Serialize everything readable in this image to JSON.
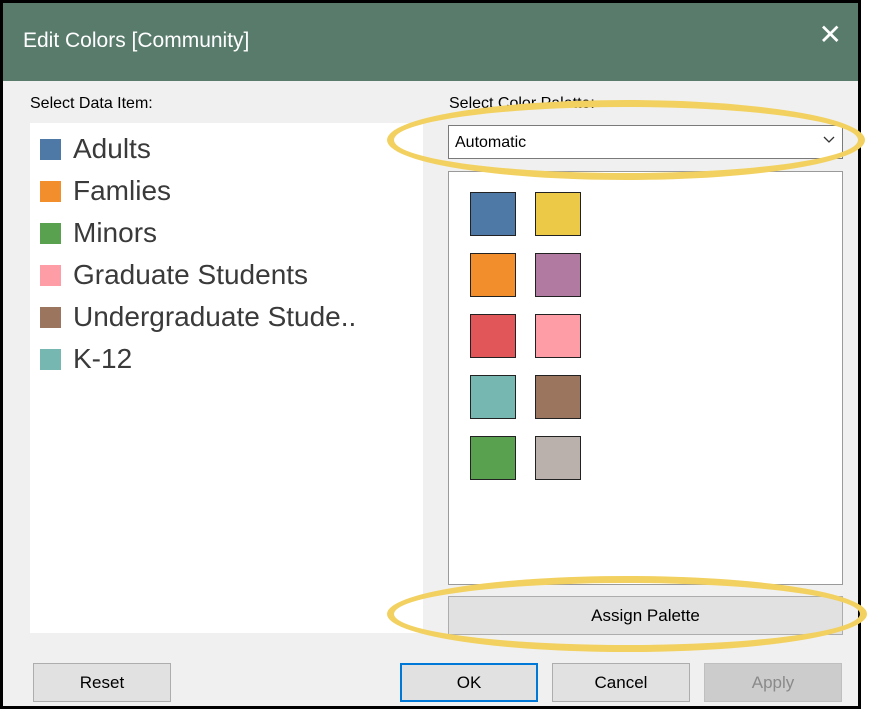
{
  "window": {
    "title": "Edit Colors [Community]"
  },
  "labels": {
    "data_item": "Select Data Item:",
    "palette": "Select Color Palette:"
  },
  "data_items": [
    {
      "label": "Adults",
      "color": "#4e79a7"
    },
    {
      "label": "Famlies",
      "color": "#f28e2b"
    },
    {
      "label": "Minors",
      "color": "#59a14f"
    },
    {
      "label": "Graduate Students",
      "color": "#ff9da7"
    },
    {
      "label": "Undergraduate Stude..",
      "color": "#9c755f"
    },
    {
      "label": "K-12",
      "color": "#76b7b2"
    }
  ],
  "palette_select": {
    "value": "Automatic"
  },
  "palette_swatches": [
    [
      "#4e79a7",
      "#edc948"
    ],
    [
      "#f28e2b",
      "#b07aa1"
    ],
    [
      "#e15759",
      "#ff9da7"
    ],
    [
      "#76b7b2",
      "#9c755f"
    ],
    [
      "#59a14f",
      "#bab0ac"
    ]
  ],
  "buttons": {
    "assign": "Assign Palette",
    "reset": "Reset",
    "ok": "OK",
    "cancel": "Cancel",
    "apply": "Apply"
  },
  "annotation_color": "#f2d160"
}
